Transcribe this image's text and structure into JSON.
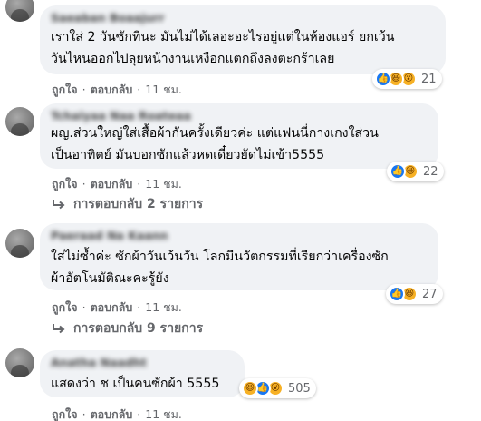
{
  "comments": [
    {
      "author": "Saeaban Boaajurr",
      "text_lines": [
        "เราใส่ 2 วันซักทีนะ มันไม่ได้เลอะอะไรอยู่แต่ในห้องแอร์ ยกเว้น",
        "วันไหนออกไปลุยหน้างานเหงือกแตกถึงลงตะกร้าเลย"
      ],
      "reactions": [
        "like",
        "haha",
        "wow"
      ],
      "reaction_count": "21",
      "like_label": "ถูกใจ",
      "reply_label": "ตอบกลับ",
      "time": "11 ชม."
    },
    {
      "author": "Tchaiyaa Naa Roateaa",
      "text_lines": [
        "ผญ.ส่วนใหญ่ใส่เสื้อผ้ากันครั้งเดียวค่ะ แต่แฟนนี่กางเกงใส่วน",
        "เป็นอาทิตย์ มันบอกซักแล้วหดเดี๋ยวยัดไม่เข้า5555"
      ],
      "reactions": [
        "like",
        "haha"
      ],
      "reaction_count": "22",
      "like_label": "ถูกใจ",
      "reply_label": "ตอบกลับ",
      "time": "11 ชม.",
      "replies_text": "การตอบกลับ 2 รายการ"
    },
    {
      "author": "Paeraad Na Kaann",
      "text_lines": [
        "ใส่ไม่ซ้ำค่ะ ซักผ้าวันเว้นวัน โลกมีนวัตกรรมที่เรียกว่าเครื่องซัก",
        "ผ้าอัตโนมัติณะคะรู้ยัง"
      ],
      "reactions": [
        "like",
        "haha"
      ],
      "reaction_count": "27",
      "like_label": "ถูกใจ",
      "reply_label": "ตอบกลับ",
      "time": "11 ชม.",
      "replies_text": "การตอบกลับ 9 รายการ"
    },
    {
      "author": "Anatha Naadht",
      "text_lines": [
        "แสดงว่า ช เป็นคนซักผ้า 5555"
      ],
      "reactions": [
        "haha",
        "like",
        "wow"
      ],
      "reaction_count": "505",
      "like_label": "ถูกใจ",
      "reply_label": "ตอบกลับ",
      "time": "11 ชม."
    }
  ],
  "colors": {
    "bubble": "#f0f2f5",
    "meta_text": "#65676b",
    "like_blue": "#1877f2",
    "haha_yellow": "#f7b125"
  }
}
